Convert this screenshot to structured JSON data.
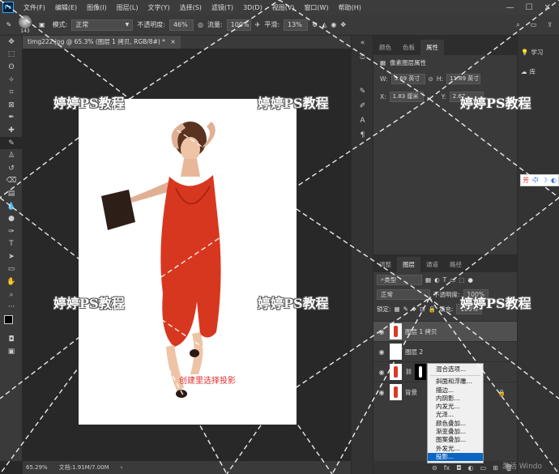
{
  "menubar": {
    "logo": "Ps",
    "items": [
      "文件(F)",
      "编辑(E)",
      "图像(I)",
      "图层(L)",
      "文字(Y)",
      "选择(S)",
      "滤镜(T)",
      "3D(D)",
      "视图(V)",
      "窗口(W)",
      "帮助(H)"
    ],
    "controls": [
      "—",
      "☐",
      "✕"
    ]
  },
  "options": {
    "brush_size": "143",
    "mode_label": "模式:",
    "mode_value": "正常",
    "opacity_label": "不透明度:",
    "opacity_value": "46%",
    "flow_label": "流量:",
    "flow_value": "100%",
    "smooth_label": "平滑:",
    "smooth_value": "13%"
  },
  "document": {
    "tab_title": "timg222.jpg @ 65.3% (图层 1 拷贝, RGB/8#) *",
    "close": "×",
    "caption": "创建里选择投影"
  },
  "status": {
    "zoom": "65.29%",
    "doc_size": "文档:1.91M/7.00M"
  },
  "props_panel": {
    "tabs": [
      "颜色",
      "色板",
      "属性"
    ],
    "title": "像素图层属性",
    "w_label": "W:",
    "w_value": "5.69 英寸",
    "h_label": "H:",
    "h_value": "11.89 英寸",
    "x_label": "X:",
    "x_value": "1.83 厘米",
    "y_label": "Y:",
    "y_value": "2.67"
  },
  "layers_panel": {
    "tabs": [
      "调整",
      "图层",
      "通道",
      "路径"
    ],
    "filter_label": "类型",
    "blend_mode": "正常",
    "opacity_label": "不透明度:",
    "opacity_value": "100%",
    "lock_label": "锁定:",
    "fill_label": "填充:",
    "fill_value": "100%",
    "layers": [
      {
        "name": "图层 1 拷贝"
      },
      {
        "name": "图层 2"
      },
      {
        "name": ""
      },
      {
        "name": "背景"
      }
    ]
  },
  "context_menu": {
    "items": [
      "混合选项...",
      "斜面和浮雕...",
      "描边...",
      "内阴影...",
      "内发光...",
      "光泽...",
      "颜色叠加...",
      "渐变叠加...",
      "图案叠加...",
      "外发光...",
      "投影..."
    ],
    "highlighted": "投影..."
  },
  "side_panel": {
    "items": [
      {
        "icon": "bulb-icon",
        "label": "学习"
      },
      {
        "icon": "library-icon",
        "label": "库"
      }
    ]
  },
  "ime": {
    "items": [
      "芳",
      "中",
      "☽",
      "◐"
    ]
  },
  "watermark": {
    "text": "婷婷PS教程"
  },
  "activate_text": "激活 Windo"
}
